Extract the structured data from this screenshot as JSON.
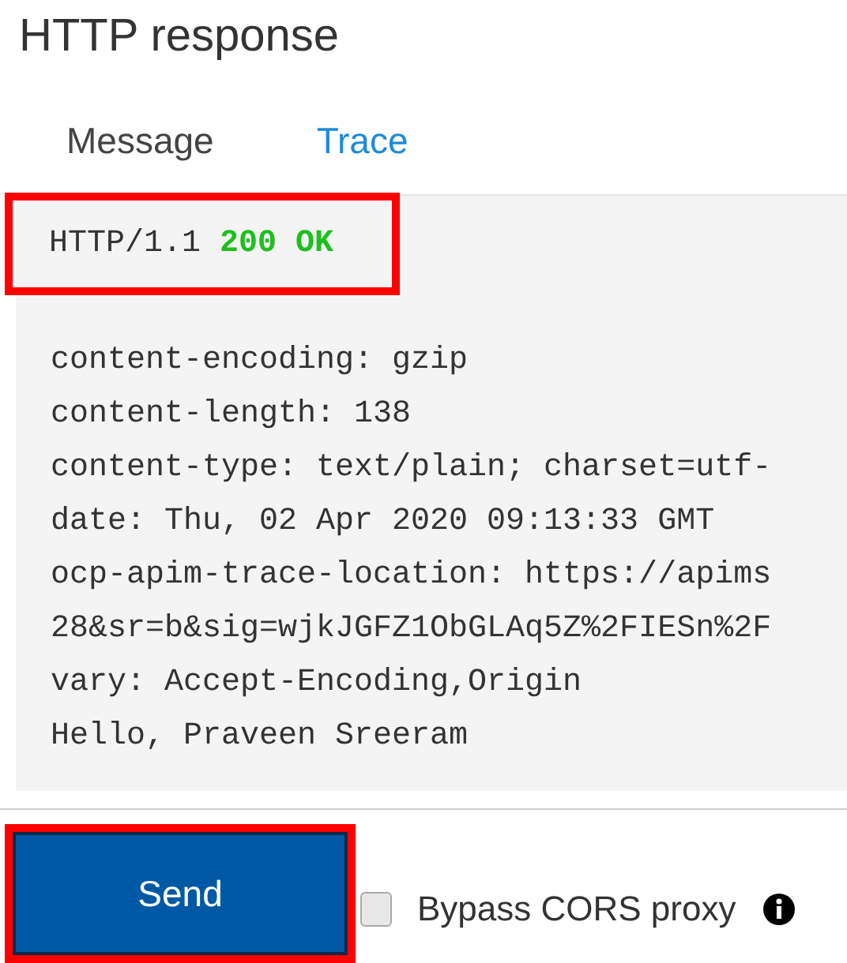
{
  "title": "HTTP response",
  "tabs": [
    {
      "label": "Message",
      "selected": true
    },
    {
      "label": "Trace",
      "selected": false
    }
  ],
  "response": {
    "status_line": {
      "protocol": "HTTP/1.1",
      "status": "200 OK",
      "highlighted": true
    },
    "lines": [
      "content-encoding: gzip",
      "content-length: 138",
      "content-type: text/plain; charset=utf-",
      "date: Thu, 02 Apr 2020 09:13:33 GMT",
      "ocp-apim-trace-location: https://apims",
      "28&sr=b&sig=wjkJGFZ1ObGLAq5Z%2FIESn%2F",
      "vary: Accept-Encoding,Origin",
      "Hello, Praveen Sreeram"
    ]
  },
  "send_button": {
    "label": "Send",
    "highlighted": true
  },
  "bypass_cors": {
    "label": "Bypass CORS proxy",
    "checked": false
  }
}
